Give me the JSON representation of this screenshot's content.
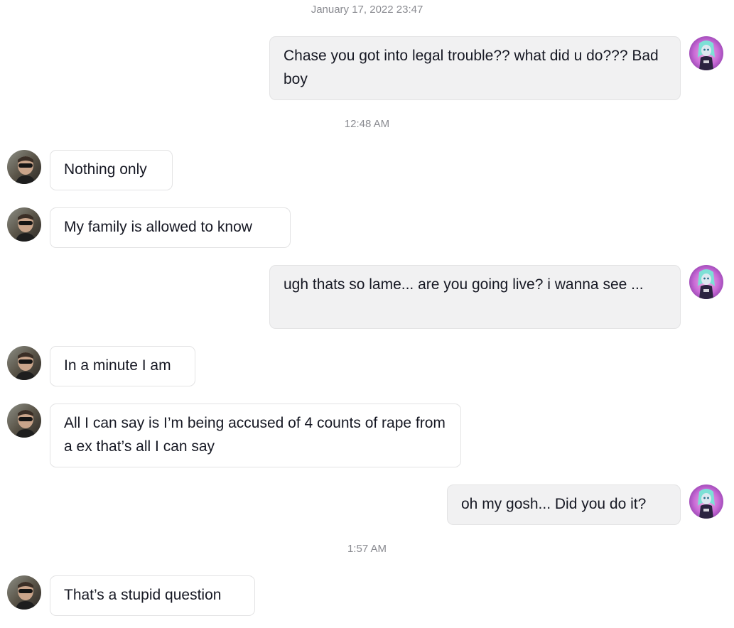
{
  "conversation": {
    "timestamps": {
      "t1": "January 17, 2022 23:47",
      "t2": "12:48 AM",
      "t3": "1:57 AM"
    },
    "messages": [
      {
        "sender": "me",
        "text": "Chase you got into legal trouble?? what did u do??? Bad boy"
      },
      {
        "sender": "them",
        "text": "Nothing only"
      },
      {
        "sender": "them",
        "text": "My family is allowed to know"
      },
      {
        "sender": "me",
        "text": "ugh thats so lame... are you going live? i wanna see ..."
      },
      {
        "sender": "them",
        "text": "In a minute I am"
      },
      {
        "sender": "them",
        "text": "All I can say is I’m being accused of 4 counts of rape from a ex that’s all I can say"
      },
      {
        "sender": "me",
        "text": "oh my gosh... Did you do it?"
      },
      {
        "sender": "them",
        "text": "That’s a stupid question"
      }
    ]
  },
  "avatars": {
    "me_icon": "anime-doll-avatar",
    "them_icon": "man-sunglasses-avatar"
  },
  "colors": {
    "my_bubble_bg": "#f1f1f2",
    "their_bubble_bg": "#ffffff",
    "timestamp": "#8a8b91",
    "text": "#161823"
  }
}
